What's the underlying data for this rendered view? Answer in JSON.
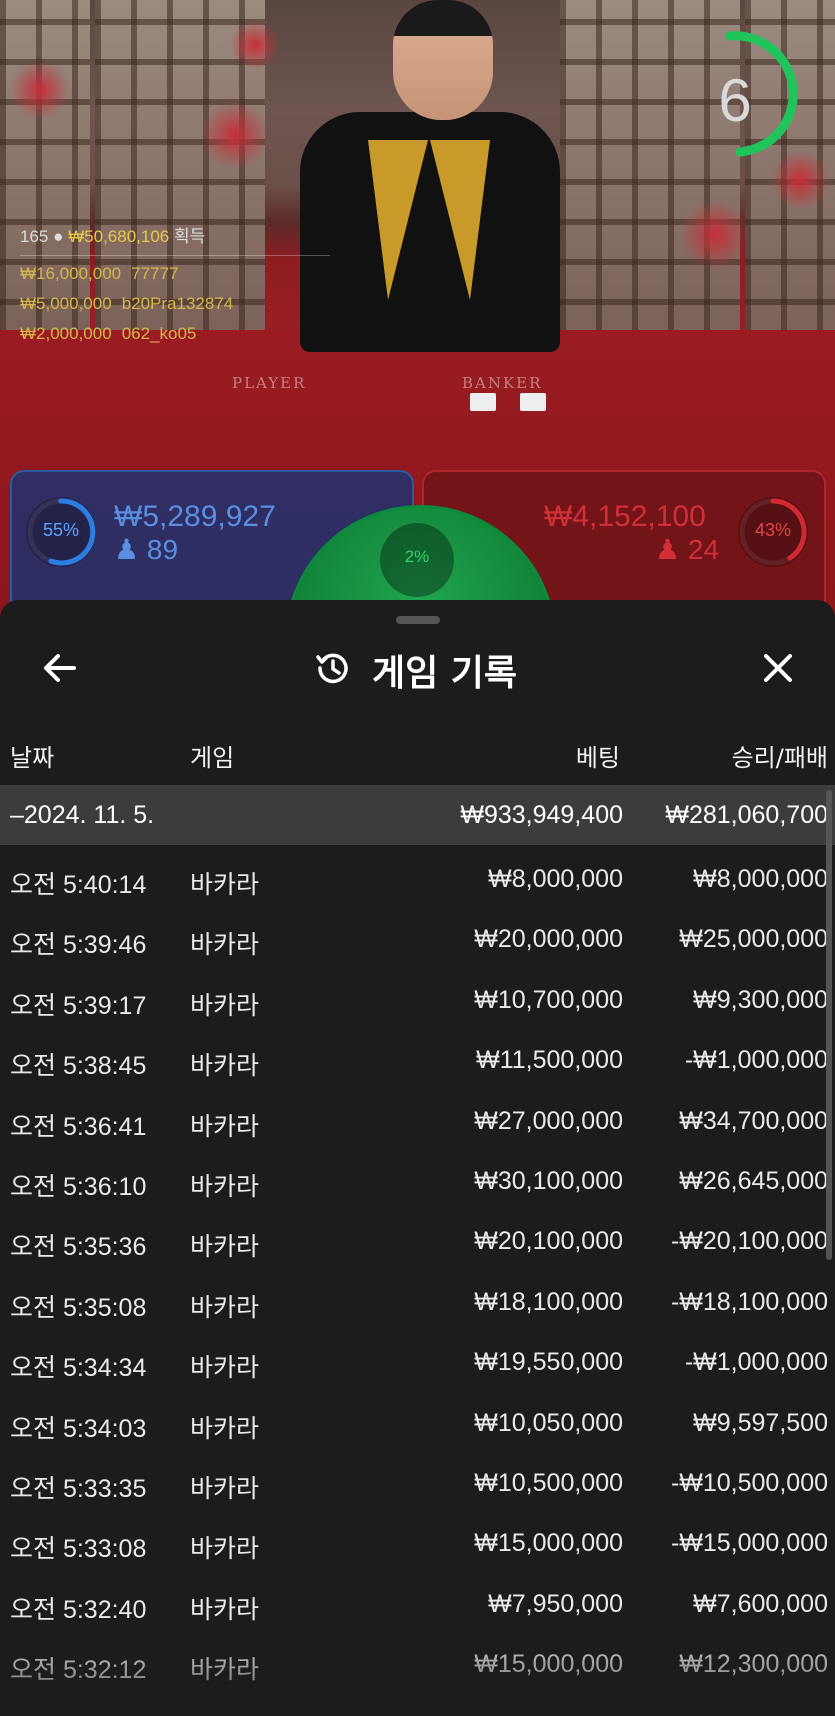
{
  "colors": {
    "accent_green": "#1fc45a",
    "player_blue": "#2c5aa0",
    "banker_red": "#c0262b",
    "sheet_bg": "#1c1c1c"
  },
  "timer": {
    "value": "6"
  },
  "leaderboard": {
    "count": "165",
    "person_icon": "person-icon",
    "total": "₩50,680,106",
    "suffix": "획득",
    "rows": [
      {
        "amount": "₩16,000,000",
        "name": "77777"
      },
      {
        "amount": "₩5,000,000",
        "name": "b20Pra132874"
      },
      {
        "amount": "₩2,000,000",
        "name": "062_ko05"
      }
    ]
  },
  "table": {
    "player_label": "PLAYER",
    "banker_label": "BANKER"
  },
  "bets": {
    "player": {
      "percent": "55%",
      "amount": "₩5,289,927",
      "count": "89",
      "percent_value": 55
    },
    "banker": {
      "percent": "43%",
      "amount": "₩4,152,100",
      "count": "24",
      "percent_value": 43
    },
    "tie": {
      "percent": "2%",
      "percent_value": 2
    }
  },
  "sheet": {
    "title": "게임 기록",
    "back_icon": "arrow-left-icon",
    "history_icon": "history-icon",
    "close_icon": "close-icon",
    "headers": {
      "date": "날짜",
      "game": "게임",
      "bet": "베팅",
      "result": "승리/패배"
    },
    "summary": {
      "date": "–2024. 11. 5.",
      "bet": "₩933,949,400",
      "result": "₩281,060,700"
    },
    "rows": [
      {
        "time": "오전 5:40:14",
        "game": "바카라",
        "bet": "₩8,000,000",
        "result": "₩8,000,000"
      },
      {
        "time": "오전 5:39:46",
        "game": "바카라",
        "bet": "₩20,000,000",
        "result": "₩25,000,000"
      },
      {
        "time": "오전 5:39:17",
        "game": "바카라",
        "bet": "₩10,700,000",
        "result": "₩9,300,000"
      },
      {
        "time": "오전 5:38:45",
        "game": "바카라",
        "bet": "₩11,500,000",
        "result": "-₩1,000,000"
      },
      {
        "time": "오전 5:36:41",
        "game": "바카라",
        "bet": "₩27,000,000",
        "result": "₩34,700,000"
      },
      {
        "time": "오전 5:36:10",
        "game": "바카라",
        "bet": "₩30,100,000",
        "result": "₩26,645,000"
      },
      {
        "time": "오전 5:35:36",
        "game": "바카라",
        "bet": "₩20,100,000",
        "result": "-₩20,100,000"
      },
      {
        "time": "오전 5:35:08",
        "game": "바카라",
        "bet": "₩18,100,000",
        "result": "-₩18,100,000"
      },
      {
        "time": "오전 5:34:34",
        "game": "바카라",
        "bet": "₩19,550,000",
        "result": "-₩1,000,000"
      },
      {
        "time": "오전 5:34:03",
        "game": "바카라",
        "bet": "₩10,050,000",
        "result": "₩9,597,500"
      },
      {
        "time": "오전 5:33:35",
        "game": "바카라",
        "bet": "₩10,500,000",
        "result": "-₩10,500,000"
      },
      {
        "time": "오전 5:33:08",
        "game": "바카라",
        "bet": "₩15,000,000",
        "result": "-₩15,000,000"
      },
      {
        "time": "오전 5:32:40",
        "game": "바카라",
        "bet": "₩7,950,000",
        "result": "₩7,600,000"
      },
      {
        "time": "오전 5:32:12",
        "game": "바카라",
        "bet": "₩15,000,000",
        "result": "₩12,300,000"
      }
    ]
  }
}
